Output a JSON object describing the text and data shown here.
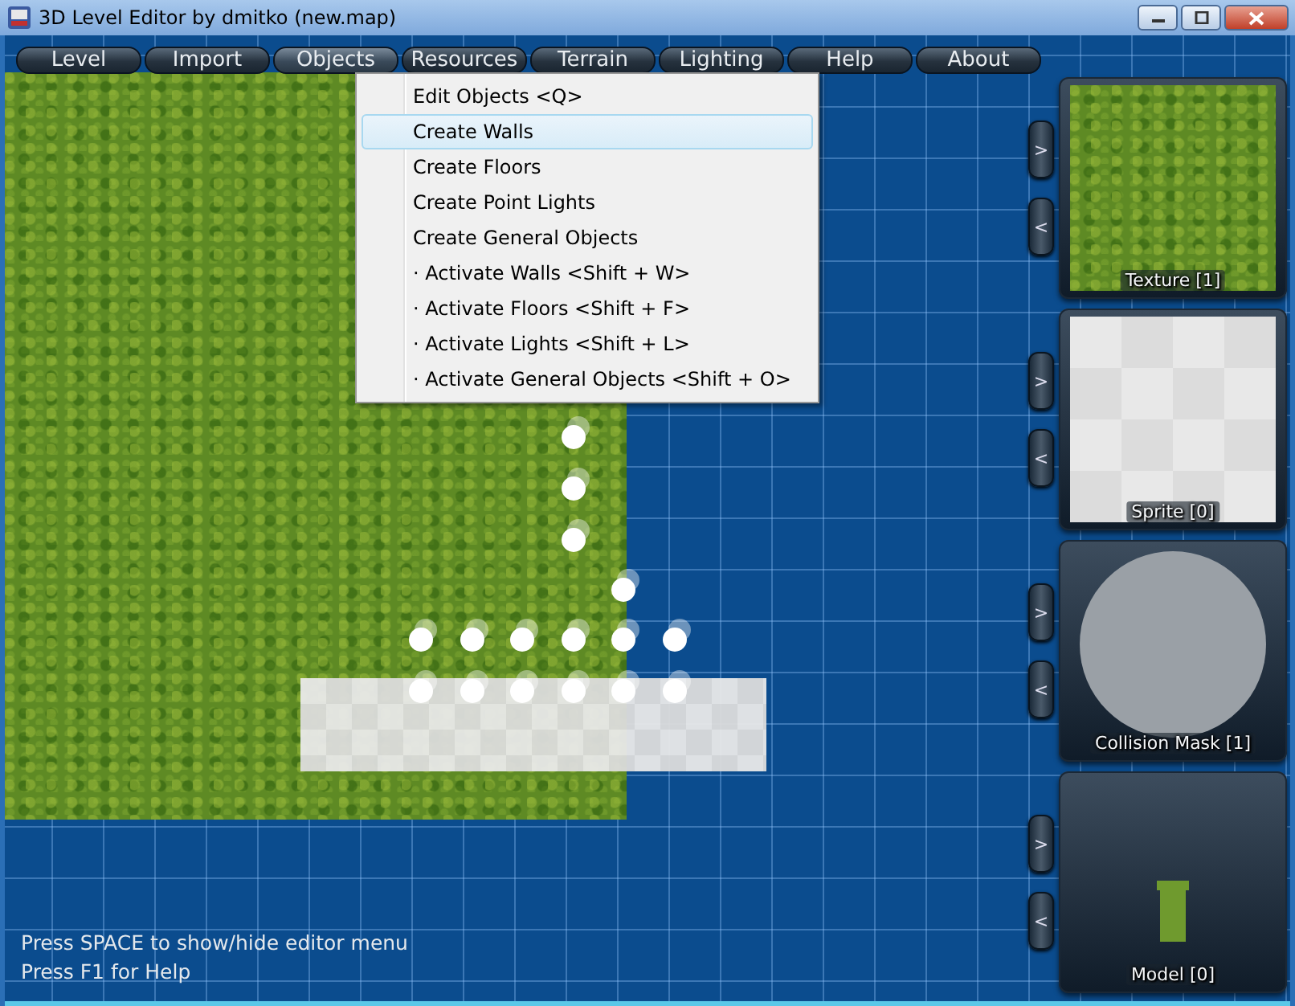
{
  "window": {
    "title": "3D Level Editor by dmitko  (new.map)"
  },
  "menu_bar": [
    {
      "label": "Level",
      "selected": false
    },
    {
      "label": "Import",
      "selected": false
    },
    {
      "label": "Objects",
      "selected": true
    },
    {
      "label": "Resources",
      "selected": false
    },
    {
      "label": "Terrain",
      "selected": false
    },
    {
      "label": "Lighting",
      "selected": false
    },
    {
      "label": "Help",
      "selected": false
    },
    {
      "label": "About",
      "selected": false
    }
  ],
  "dropdown": [
    {
      "label": "Edit Objects <Q>",
      "selected": false
    },
    {
      "label": "Create Walls",
      "selected": true
    },
    {
      "label": "Create Floors",
      "selected": false
    },
    {
      "label": "Create Point Lights",
      "selected": false
    },
    {
      "label": "Create General Objects",
      "selected": false
    },
    {
      "label": "· Activate Walls <Shift + W>",
      "selected": false
    },
    {
      "label": "· Activate Floors <Shift + F>",
      "selected": false
    },
    {
      "label": "· Activate Lights <Shift + L>",
      "selected": false
    },
    {
      "label": "· Activate General Objects <Shift + O>",
      "selected": false
    }
  ],
  "panels": [
    {
      "kind": "texture",
      "label": "Texture [1]",
      "next": ">",
      "prev": "<"
    },
    {
      "kind": "sprite",
      "label": "Sprite [0]",
      "next": ">",
      "prev": "<"
    },
    {
      "kind": "mask",
      "label": "Collision Mask [1]",
      "next": ">",
      "prev": "<"
    },
    {
      "kind": "model",
      "label": "Model [0]",
      "next": ">",
      "prev": "<"
    }
  ],
  "hints": [
    "Press SPACE to show/hide editor menu",
    "Press F1 for Help"
  ]
}
